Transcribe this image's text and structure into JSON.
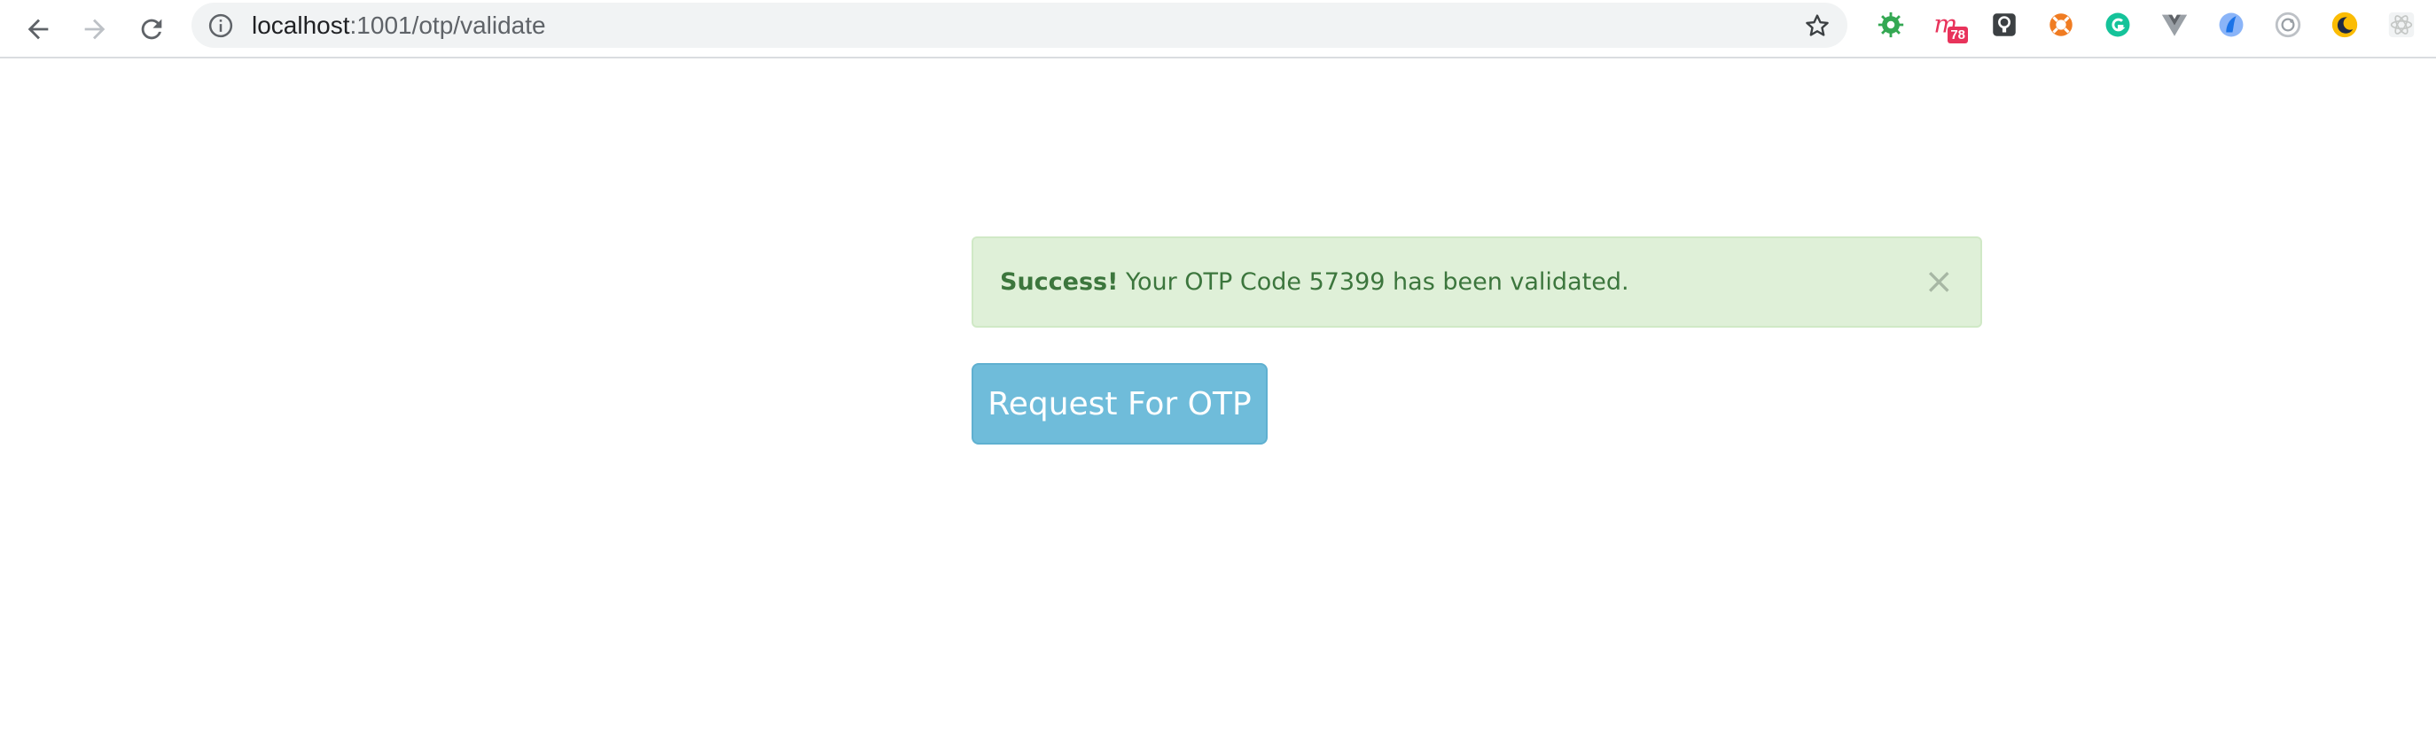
{
  "browser": {
    "url_host": "localhost",
    "url_path": ":1001/otp/validate",
    "extensions": [
      {
        "name": "bug-extension-icon",
        "color": "#34a853"
      },
      {
        "name": "notion-extension-icon",
        "color": "#e8335b",
        "badge": "78"
      },
      {
        "name": "bulb-extension-icon",
        "color": "#3c4043"
      },
      {
        "name": "lifebuoy-extension-icon",
        "color": "#f07c22"
      },
      {
        "name": "grammarly-extension-icon",
        "color": "#15c39a"
      },
      {
        "name": "vue-extension-icon",
        "color": "#9aa0a6"
      },
      {
        "name": "nordpass-extension-icon",
        "color": "#4285f4"
      },
      {
        "name": "sync-extension-icon",
        "color": "#bdc1c6"
      },
      {
        "name": "dark-reader-extension-icon",
        "color": "#fbbc04"
      },
      {
        "name": "react-extension-icon",
        "color": "#dadce0"
      }
    ]
  },
  "alert": {
    "strong": "Success!",
    "message": " Your OTP Code 57399 has been validated.",
    "close_glyph": "×",
    "colors": {
      "background": "#dff0d8",
      "text": "#3c763d"
    }
  },
  "otp_button": {
    "label": "Request For OTP",
    "color": "#6fbcda"
  }
}
